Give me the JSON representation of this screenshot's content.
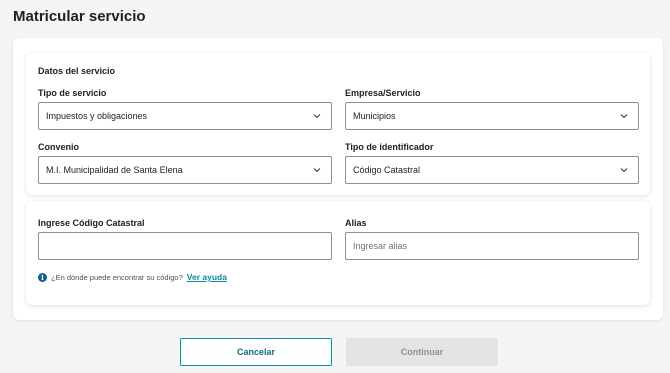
{
  "page": {
    "title": "Matricular servicio"
  },
  "service": {
    "section_title": "Datos del servicio",
    "tipo_servicio": {
      "label": "Tipo de servicio",
      "value": "Impuestos y obligaciones"
    },
    "empresa": {
      "label": "Empresa/Servicio",
      "value": "Municipios"
    },
    "convenio": {
      "label": "Convenio",
      "value": "M.I. Municipalidad de Santa Elena"
    },
    "tipo_identificador": {
      "label": "Tipo de identificador",
      "value": "Código Catastral"
    }
  },
  "identifier": {
    "codigo": {
      "label": "Ingrese Código Catastral",
      "value": ""
    },
    "alias": {
      "label": "Alias",
      "placeholder": "Ingresar alias"
    },
    "help_text": "¿En dónde puede encontrar su código?",
    "help_link": "Ver ayuda",
    "info_glyph": "i"
  },
  "actions": {
    "cancel": "Cancelar",
    "continue": "Continuar"
  },
  "icons": {
    "info": "info-icon",
    "dropdown": "chevron-down-icon"
  },
  "colors": {
    "accent": "#0c89a3",
    "info": "#0e5e8c",
    "disabled_bg": "#e3e4e6"
  }
}
